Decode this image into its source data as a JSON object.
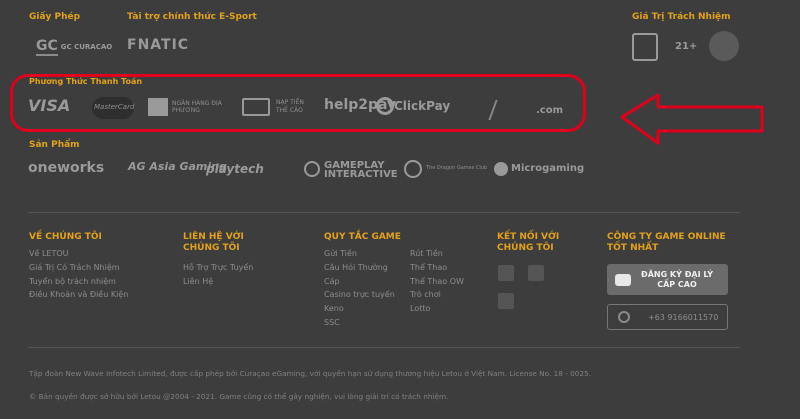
{
  "licenses": {
    "title": "Giấy Phép",
    "logo": "GC CURACAO"
  },
  "sponsor": {
    "title": "Tài trợ chính thức E-Sport",
    "logo": "FNATIC"
  },
  "responsible": {
    "title": "Giá Trị Trách Nhiệm",
    "age": "21+"
  },
  "payment": {
    "title": "Phương Thức Thanh Toán",
    "items": [
      "VISA",
      "MasterCard",
      "NGÂN HÀNG ĐỊA PHƯƠNG",
      "NẠP TIỀN THẺ CÀO",
      "help2pay",
      "ClickPay",
      ".com"
    ]
  },
  "products": {
    "title": "Sản Phẩm",
    "items": [
      "oneworks",
      "AG Asia Gaming",
      "playtech",
      "GAMEPLAY INTERACTIVE",
      "The Dragon Games Club",
      "Microgaming"
    ]
  },
  "footer": {
    "about": {
      "title": "VỀ CHÚNG TÔI",
      "links": [
        "Về LETOU",
        "Giá Trị Có Trách Nhiệm",
        "Tuyển bộ trách nhiệm",
        "Điều Khoản và Điều Kiện"
      ]
    },
    "contact": {
      "title": "LIÊN HỆ VỚI CHÚNG TÔI",
      "links": [
        "Hỗ Trợ Trực Tuyến",
        "Liên Hệ"
      ]
    },
    "rules": {
      "title": "QUY TẮC GAME",
      "col1": [
        "Gửi Tiền",
        "Câu Hỏi Thường",
        "Cáp",
        "Casino trực tuyến",
        "Keno",
        "SSC"
      ],
      "col2": [
        "Rút Tiền",
        "Thể Thao",
        "Thể Thao OW",
        "Trò chơi",
        "Lotto"
      ]
    },
    "connect": {
      "title": "KẾT NỐI VỚI CHÚNG TÔI"
    },
    "company": {
      "title": "CÔNG TY GAME ONLINE TỐT NHẤT",
      "agent_button": "ĐĂNG KÝ ĐẠI LÝ CẤP CAO",
      "phone": "+63 9166011570"
    },
    "legal": "Tập đoàn New Wave Infotech Limited, được cấp phép bởi Curaçao eGaming, với quyền hạn sử dụng thương hiệu Letou ở Việt Nam. License No. 18 - 0025.",
    "copyright": "© Bản quyền được sở hữu bởi Letou @2004 - 2021. Game cũng có thể gây nghiện, vui lòng giải trí có trách nhiệm."
  }
}
